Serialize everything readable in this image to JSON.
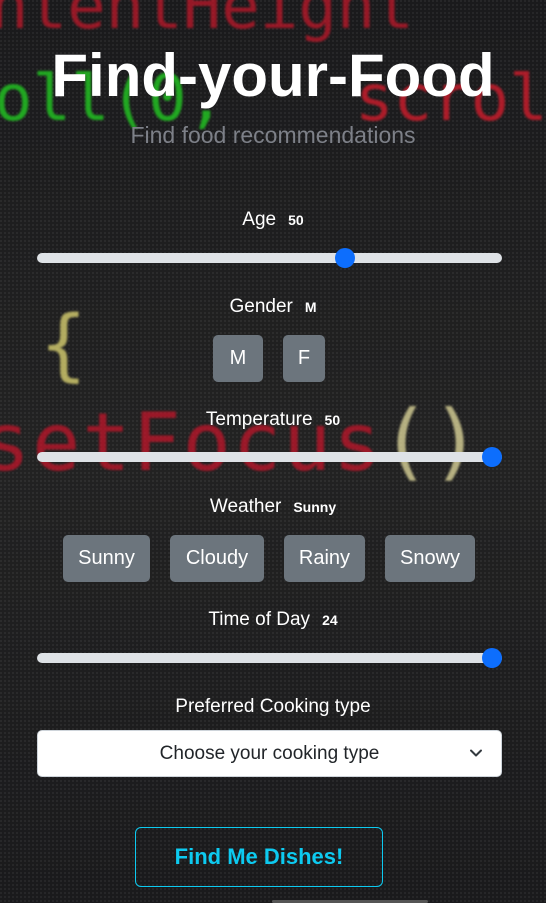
{
  "header": {
    "title": "Find-your-Food",
    "subtitle": "Find food recommendations"
  },
  "background": {
    "code_words": [
      "ntentHeight",
      "oll(0,",
      "scroll",
      "{",
      "setFocus",
      "()"
    ]
  },
  "age": {
    "label": "Age",
    "value": "50",
    "fraction": 0.67
  },
  "gender": {
    "label": "Gender",
    "value": "M",
    "options": [
      "M",
      "F"
    ]
  },
  "temperature": {
    "label": "Temperature",
    "value": "50",
    "fraction": 1.0
  },
  "weather": {
    "label": "Weather",
    "value": "Sunny",
    "options": [
      "Sunny",
      "Cloudy",
      "Rainy",
      "Snowy"
    ]
  },
  "time_of_day": {
    "label": "Time of Day",
    "value": "24",
    "fraction": 1.0
  },
  "cooking": {
    "label": "Preferred Cooking type",
    "placeholder": "Choose your cooking type"
  },
  "submit": {
    "label": "Find Me Dishes!"
  },
  "colors": {
    "accent": "#0d6efd",
    "track": "#dee2e6",
    "button_bg": "#6c757d",
    "submit_outline": "#0dcaf0",
    "subtitle": "#7d8088"
  }
}
